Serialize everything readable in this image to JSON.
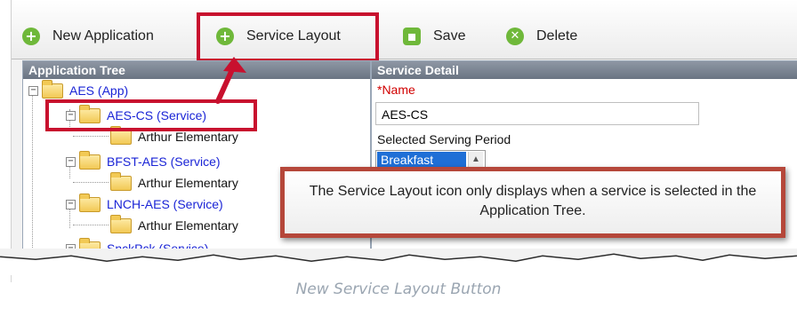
{
  "toolbar": {
    "buttons": [
      {
        "label": "New Application",
        "icon": "plus-circle-icon"
      },
      {
        "label": "Service Layout",
        "icon": "plus-circle-icon"
      },
      {
        "label": "Save",
        "icon": "save-icon"
      },
      {
        "label": "Delete",
        "icon": "delete-icon"
      }
    ]
  },
  "tree": {
    "header": "Application Tree",
    "items": [
      {
        "label": "AES (App)",
        "level": 0
      },
      {
        "label": "AES-CS (Service)",
        "level": 1
      },
      {
        "label": "Arthur Elementary",
        "level": 2
      },
      {
        "label": "BFST-AES (Service)",
        "level": 1
      },
      {
        "label": "Arthur Elementary",
        "level": 2
      },
      {
        "label": "LNCH-AES (Service)",
        "level": 1
      },
      {
        "label": "Arthur Elementary",
        "level": 2
      },
      {
        "label": "SnckPck (Service)",
        "level": 1
      }
    ]
  },
  "detail": {
    "header": "Service Detail",
    "name_required": "*Name",
    "name_value": "AES-CS",
    "period_label": "Selected Serving Period",
    "period_value": "Breakfast"
  },
  "callout": {
    "text": "The Service Layout icon only displays when a service is selected in the Application Tree."
  },
  "caption": "New Service Layout Button",
  "colors": {
    "highlight": "#c8102e",
    "callout_border": "#b5473a",
    "icon_green": "#6fb83a",
    "link_blue": "#1a24d6"
  }
}
